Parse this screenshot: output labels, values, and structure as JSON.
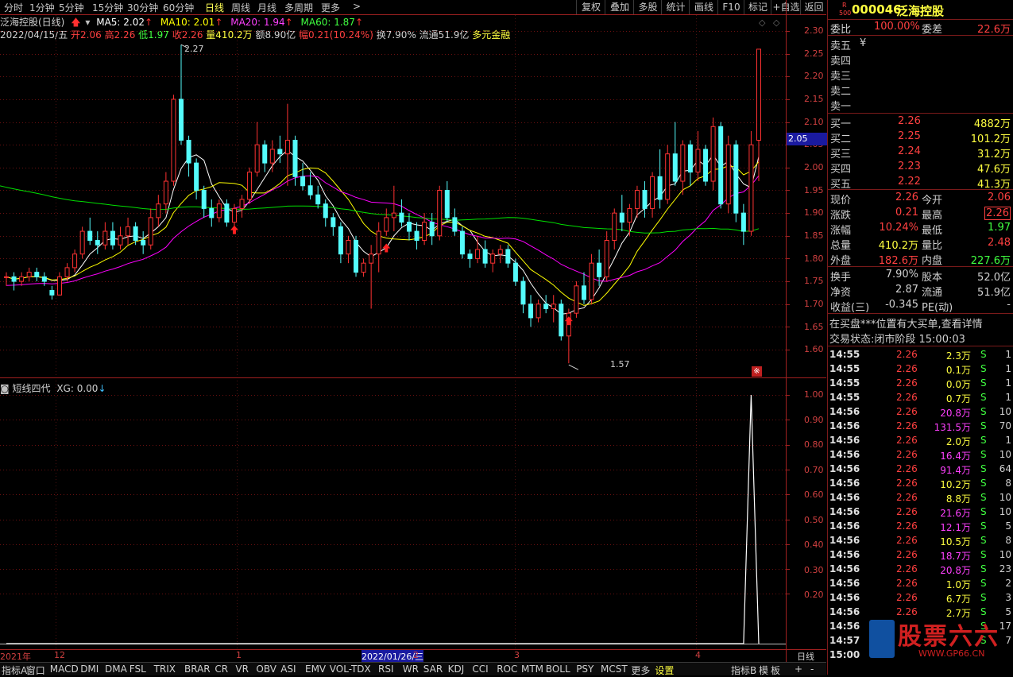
{
  "toolbar": {
    "periods": [
      "分时",
      "1分钟",
      "5分钟",
      "15分钟",
      "30分钟",
      "60分钟",
      "日线",
      "周线",
      "月线",
      "多周期",
      "更多"
    ],
    "active": "日线",
    "more_arrow": ">",
    "buttons": [
      "复权",
      "叠加",
      "多股",
      "统计",
      "画线",
      "F10",
      "标记",
      "+自选",
      "返回"
    ]
  },
  "chart_header": {
    "name": "泛海控股(日线)",
    "ma5": "MA5: 2.02",
    "ma10": "MA10: 2.01",
    "ma20": "MA20: 1.94",
    "ma60": "MA60: 1.87"
  },
  "day_info": {
    "date": "2022/04/15/五",
    "open": "开2.06",
    "high": "高2.26",
    "low": "低1.97",
    "close": "收2.26",
    "vol": "量410.2万",
    "amount": "额8.90亿",
    "change": "幅0.21(10.24%)",
    "turnover": "换7.90%",
    "float": "流通51.9亿",
    "tag": "多元金融"
  },
  "price_axis": {
    "labels": [
      "2.30",
      "2.25",
      "2.20",
      "2.15",
      "2.10",
      "2.05",
      "2.00",
      "1.95",
      "1.90",
      "1.85",
      "1.80",
      "1.75",
      "1.70",
      "1.65",
      "1.60"
    ],
    "current": "2.05"
  },
  "annotations": {
    "high_label": "2.27",
    "low_label": "1.57"
  },
  "indicator": {
    "title": "短线四代",
    "xg": "XG: 0.00",
    "arrow": "↓",
    "axis": [
      "1.00",
      "0.90",
      "0.80",
      "0.70",
      "0.60",
      "0.50",
      "0.40",
      "0.30",
      "0.20"
    ]
  },
  "x_axis": {
    "labels": [
      "2021年",
      "12",
      "1",
      "2022/01/26/三",
      "2",
      "3",
      "4"
    ],
    "right": "日线"
  },
  "tabs": [
    "指标A",
    "窗口",
    "MACD",
    "DMI",
    "DMA",
    "FSL",
    "TRIX",
    "BRAR",
    "CR",
    "VR",
    "OBV",
    "ASI",
    "EMV",
    "VOL-TDX",
    "RSI",
    "WR",
    "SAR",
    "KDJ",
    "CCI",
    "ROC",
    "MTM",
    "BOLL",
    "PSY",
    "MCST",
    "更多",
    "设置"
  ],
  "tabs_right": [
    "指标B",
    "模",
    "板",
    "+",
    "-"
  ],
  "stock": {
    "badge_top": "R",
    "badge_bot": "500",
    "code": "000046",
    "name": "泛海控股"
  },
  "quote": {
    "weibi_label": "委比",
    "weibi": "100.00%",
    "weicha_label": "委差",
    "weicha": "22.6万",
    "sell": [
      {
        "label": "卖五",
        "extra": "¥"
      },
      {
        "label": "卖四",
        "extra": ""
      },
      {
        "label": "卖三",
        "extra": ""
      },
      {
        "label": "卖二",
        "extra": ""
      },
      {
        "label": "卖一",
        "extra": ""
      }
    ],
    "buy": [
      {
        "label": "买一",
        "price": "2.26",
        "vol": "4882万"
      },
      {
        "label": "买二",
        "price": "2.25",
        "vol": "101.2万"
      },
      {
        "label": "买三",
        "price": "2.24",
        "vol": "31.2万"
      },
      {
        "label": "买四",
        "price": "2.23",
        "vol": "47.6万"
      },
      {
        "label": "买五",
        "price": "2.22",
        "vol": "41.3万"
      }
    ],
    "stats": [
      {
        "l1": "现价",
        "v1": "2.26",
        "l2": "今开",
        "v2": "2.06",
        "c1": "#ff4040",
        "c2": "#ff4040"
      },
      {
        "l1": "涨跌",
        "v1": "0.21",
        "l2": "最高",
        "v2": "2.26",
        "c1": "#ff4040",
        "c2": "#ff4040"
      },
      {
        "l1": "涨幅",
        "v1": "10.24%",
        "l2": "最低",
        "v2": "1.97",
        "c1": "#ff4040",
        "c2": "#40ff40"
      },
      {
        "l1": "总量",
        "v1": "410.2万",
        "l2": "量比",
        "v2": "2.48",
        "c1": "#ffff40",
        "c2": "#ff4040"
      },
      {
        "l1": "外盘",
        "v1": "182.6万",
        "l2": "内盘",
        "v2": "227.6万",
        "c1": "#ff4040",
        "c2": "#40ff40"
      }
    ],
    "fin": [
      {
        "l1": "换手",
        "v1": "7.90%",
        "l2": "股本",
        "v2": "52.0亿"
      },
      {
        "l1": "净资",
        "v1": "2.87",
        "l2": "流通",
        "v2": "51.9亿"
      },
      {
        "l1": "收益(三)",
        "v1": "-0.345",
        "l2": "PE(动)",
        "v2": "-"
      }
    ],
    "notice": "在买盘***位置有大买单,查看详情",
    "status": "交易状态:闭市阶段 15:00:03"
  },
  "ticks": [
    {
      "t": "14:55",
      "p": "2.26",
      "v": "2.3万",
      "s": "S",
      "n": "1",
      "vc": "#ffff40"
    },
    {
      "t": "14:55",
      "p": "2.26",
      "v": "0.1万",
      "s": "S",
      "n": "1",
      "vc": "#ffff40"
    },
    {
      "t": "14:55",
      "p": "2.26",
      "v": "0.0万",
      "s": "S",
      "n": "1",
      "vc": "#ffff40"
    },
    {
      "t": "14:55",
      "p": "2.26",
      "v": "0.7万",
      "s": "S",
      "n": "1",
      "vc": "#ffff40"
    },
    {
      "t": "14:56",
      "p": "2.26",
      "v": "20.8万",
      "s": "S",
      "n": "10",
      "vc": "#ff40ff"
    },
    {
      "t": "14:56",
      "p": "2.26",
      "v": "131.5万",
      "s": "S",
      "n": "70",
      "vc": "#ff40ff"
    },
    {
      "t": "14:56",
      "p": "2.26",
      "v": "2.0万",
      "s": "S",
      "n": "1",
      "vc": "#ffff40"
    },
    {
      "t": "14:56",
      "p": "2.26",
      "v": "16.4万",
      "s": "S",
      "n": "10",
      "vc": "#ff40ff"
    },
    {
      "t": "14:56",
      "p": "2.26",
      "v": "91.4万",
      "s": "S",
      "n": "64",
      "vc": "#ff40ff"
    },
    {
      "t": "14:56",
      "p": "2.26",
      "v": "10.2万",
      "s": "S",
      "n": "8",
      "vc": "#ffff40"
    },
    {
      "t": "14:56",
      "p": "2.26",
      "v": "8.8万",
      "s": "S",
      "n": "10",
      "vc": "#ffff40"
    },
    {
      "t": "14:56",
      "p": "2.26",
      "v": "21.6万",
      "s": "S",
      "n": "10",
      "vc": "#ff40ff"
    },
    {
      "t": "14:56",
      "p": "2.26",
      "v": "12.1万",
      "s": "S",
      "n": "5",
      "vc": "#ff40ff"
    },
    {
      "t": "14:56",
      "p": "2.26",
      "v": "10.5万",
      "s": "S",
      "n": "8",
      "vc": "#ffff40"
    },
    {
      "t": "14:56",
      "p": "2.26",
      "v": "18.7万",
      "s": "S",
      "n": "10",
      "vc": "#ff40ff"
    },
    {
      "t": "14:56",
      "p": "2.26",
      "v": "20.8万",
      "s": "S",
      "n": "23",
      "vc": "#ff40ff"
    },
    {
      "t": "14:56",
      "p": "2.26",
      "v": "1.0万",
      "s": "S",
      "n": "2",
      "vc": "#ffff40"
    },
    {
      "t": "14:56",
      "p": "2.26",
      "v": "6.7万",
      "s": "S",
      "n": "3",
      "vc": "#ffff40"
    },
    {
      "t": "14:56",
      "p": "2.26",
      "v": "2.7万",
      "s": "S",
      "n": "5",
      "vc": "#ffff40"
    },
    {
      "t": "14:56",
      "p": "",
      "v": "",
      "s": "S",
      "n": "17",
      "vc": "#ffff40"
    },
    {
      "t": "14:57",
      "p": "",
      "v": "",
      "s": "S",
      "n": "7",
      "vc": "#ffff40"
    },
    {
      "t": "15:00",
      "p": "",
      "v": "",
      "s": "",
      "n": "",
      "vc": "#ffff40"
    }
  ],
  "watermark": {
    "text": "股票六六",
    "url": "WWW.GP66.CN"
  },
  "colors": {
    "up": "#ff3232",
    "down": "#54fcfc",
    "ma5": "#ffffff",
    "ma10": "#ffff00",
    "ma20": "#ff00ff",
    "ma60": "#00e000"
  },
  "chart_data": {
    "type": "candlestick",
    "ylim": [
      1.57,
      2.3
    ],
    "candles": [
      [
        1.76,
        1.77,
        1.74,
        1.76
      ],
      [
        1.76,
        1.77,
        1.73,
        1.75
      ],
      [
        1.75,
        1.77,
        1.74,
        1.76
      ],
      [
        1.76,
        1.78,
        1.75,
        1.77
      ],
      [
        1.77,
        1.78,
        1.75,
        1.76
      ],
      [
        1.76,
        1.77,
        1.74,
        1.75
      ],
      [
        1.73,
        1.74,
        1.71,
        1.72
      ],
      [
        1.72,
        1.77,
        1.72,
        1.76
      ],
      [
        1.76,
        1.79,
        1.75,
        1.78
      ],
      [
        1.78,
        1.82,
        1.77,
        1.81
      ],
      [
        1.81,
        1.87,
        1.8,
        1.86
      ],
      [
        1.86,
        1.89,
        1.83,
        1.84
      ],
      [
        1.84,
        1.86,
        1.81,
        1.83
      ],
      [
        1.83,
        1.88,
        1.82,
        1.86
      ],
      [
        1.86,
        1.88,
        1.82,
        1.83
      ],
      [
        1.83,
        1.87,
        1.82,
        1.85
      ],
      [
        1.85,
        1.89,
        1.83,
        1.87
      ],
      [
        1.87,
        1.88,
        1.83,
        1.84
      ],
      [
        1.84,
        1.86,
        1.81,
        1.83
      ],
      [
        1.83,
        1.91,
        1.82,
        1.89
      ],
      [
        1.89,
        1.94,
        1.87,
        1.92
      ],
      [
        1.92,
        1.99,
        1.9,
        1.97
      ],
      [
        1.97,
        2.16,
        1.96,
        2.15
      ],
      [
        2.15,
        2.27,
        2.05,
        2.06
      ],
      [
        2.06,
        2.07,
        1.98,
        2.01
      ],
      [
        2.01,
        2.02,
        1.93,
        1.95
      ],
      [
        1.95,
        1.96,
        1.89,
        1.91
      ],
      [
        1.91,
        1.93,
        1.87,
        1.89
      ],
      [
        1.89,
        1.93,
        1.88,
        1.92
      ],
      [
        1.92,
        1.93,
        1.87,
        1.88
      ],
      [
        1.88,
        1.92,
        1.87,
        1.91
      ],
      [
        1.91,
        1.94,
        1.89,
        1.93
      ],
      [
        1.93,
        2.0,
        1.92,
        1.99
      ],
      [
        1.99,
        2.1,
        1.98,
        2.05
      ],
      [
        2.05,
        2.06,
        1.99,
        2.01
      ],
      [
        2.01,
        2.06,
        1.99,
        2.04
      ],
      [
        2.04,
        2.07,
        2.01,
        2.03
      ],
      [
        2.03,
        2.14,
        1.96,
        2.06
      ],
      [
        2.06,
        2.07,
        1.96,
        1.98
      ],
      [
        1.98,
        2.01,
        1.95,
        1.96
      ],
      [
        1.96,
        1.99,
        1.93,
        1.94
      ],
      [
        1.94,
        1.96,
        1.91,
        1.92
      ],
      [
        1.92,
        1.93,
        1.87,
        1.89
      ],
      [
        1.89,
        1.9,
        1.85,
        1.87
      ],
      [
        1.87,
        1.88,
        1.79,
        1.81
      ],
      [
        1.81,
        1.85,
        1.79,
        1.84
      ],
      [
        1.84,
        1.85,
        1.76,
        1.77
      ],
      [
        1.77,
        1.8,
        1.76,
        1.79
      ],
      [
        1.79,
        1.83,
        1.69,
        1.81
      ],
      [
        1.81,
        1.88,
        1.77,
        1.86
      ],
      [
        1.86,
        1.91,
        1.85,
        1.89
      ],
      [
        1.89,
        1.96,
        1.86,
        1.9
      ],
      [
        1.9,
        1.93,
        1.87,
        1.88
      ],
      [
        1.88,
        1.9,
        1.84,
        1.86
      ],
      [
        1.86,
        1.88,
        1.82,
        1.84
      ],
      [
        1.84,
        1.9,
        1.83,
        1.88
      ],
      [
        1.88,
        1.9,
        1.83,
        1.85
      ],
      [
        1.85,
        1.96,
        1.84,
        1.95
      ],
      [
        1.95,
        1.97,
        1.88,
        1.89
      ],
      [
        1.89,
        1.91,
        1.85,
        1.86
      ],
      [
        1.86,
        1.87,
        1.8,
        1.81
      ],
      [
        1.81,
        1.82,
        1.78,
        1.8
      ],
      [
        1.8,
        1.85,
        1.79,
        1.82
      ],
      [
        1.82,
        1.84,
        1.78,
        1.79
      ],
      [
        1.79,
        1.82,
        1.77,
        1.81
      ],
      [
        1.81,
        1.83,
        1.79,
        1.82
      ],
      [
        1.82,
        1.83,
        1.78,
        1.79
      ],
      [
        1.79,
        1.8,
        1.74,
        1.75
      ],
      [
        1.75,
        1.76,
        1.68,
        1.7
      ],
      [
        1.7,
        1.72,
        1.65,
        1.67
      ],
      [
        1.67,
        1.71,
        1.66,
        1.7
      ],
      [
        1.7,
        1.72,
        1.68,
        1.69
      ],
      [
        1.69,
        1.72,
        1.66,
        1.7
      ],
      [
        1.7,
        1.71,
        1.62,
        1.63
      ],
      [
        1.63,
        1.69,
        1.57,
        1.68
      ],
      [
        1.68,
        1.75,
        1.67,
        1.74
      ],
      [
        1.74,
        1.77,
        1.7,
        1.71
      ],
      [
        1.71,
        1.81,
        1.7,
        1.79
      ],
      [
        1.79,
        1.82,
        1.74,
        1.76
      ],
      [
        1.76,
        1.86,
        1.75,
        1.84
      ],
      [
        1.84,
        1.91,
        1.82,
        1.9
      ],
      [
        1.9,
        1.94,
        1.86,
        1.88
      ],
      [
        1.88,
        1.92,
        1.85,
        1.91
      ],
      [
        1.91,
        1.96,
        1.89,
        1.95
      ],
      [
        1.95,
        1.97,
        1.89,
        1.91
      ],
      [
        1.91,
        1.99,
        1.89,
        1.98
      ],
      [
        1.98,
        2.04,
        1.91,
        1.93
      ],
      [
        1.93,
        2.05,
        1.92,
        2.03
      ],
      [
        2.03,
        2.1,
        1.96,
        1.97
      ],
      [
        1.97,
        2.06,
        1.94,
        2.05
      ],
      [
        2.05,
        2.06,
        1.96,
        1.99
      ],
      [
        1.99,
        2.08,
        1.97,
        2.04
      ],
      [
        2.04,
        2.05,
        1.96,
        1.97
      ],
      [
        1.97,
        2.11,
        1.95,
        2.09
      ],
      [
        2.09,
        2.1,
        1.91,
        1.92
      ],
      [
        1.92,
        2.07,
        1.9,
        2.05
      ],
      [
        2.05,
        2.06,
        1.88,
        1.9
      ],
      [
        1.9,
        1.92,
        1.83,
        1.86
      ],
      [
        1.86,
        2.08,
        1.85,
        2.05
      ],
      [
        2.06,
        2.26,
        1.97,
        2.26
      ]
    ],
    "indicator_values": {
      "XG": [
        0,
        0,
        0,
        0,
        0,
        0,
        0,
        0,
        0,
        0,
        0,
        0,
        0,
        0,
        0,
        0,
        0,
        0,
        0,
        0,
        0,
        0,
        0,
        0,
        0,
        0,
        0,
        0,
        0,
        0,
        0,
        0,
        0,
        0,
        0,
        0,
        0,
        0,
        0,
        0,
        0,
        0,
        0,
        0,
        0,
        0,
        0,
        0,
        0,
        0,
        0,
        0,
        0,
        0,
        0,
        0,
        0,
        0,
        0,
        0,
        0,
        0,
        0,
        0,
        0,
        0,
        0,
        0,
        0,
        0,
        0,
        0,
        0,
        0,
        0,
        0,
        0,
        0,
        0,
        0,
        0,
        0,
        0,
        0,
        0,
        0,
        0,
        0,
        0,
        0,
        0,
        0,
        0,
        0,
        0,
        0,
        0,
        0,
        1,
        0
      ]
    },
    "indicator_ylim": [
      0,
      1.0
    ]
  }
}
